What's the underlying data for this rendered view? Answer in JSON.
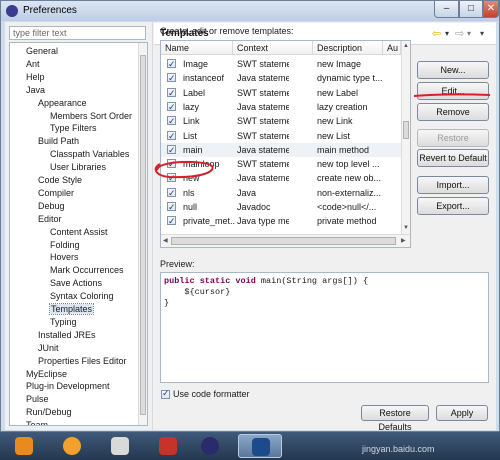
{
  "window": {
    "title": "Preferences",
    "min_label": "–",
    "max_label": "□",
    "close_label": "✕"
  },
  "filter": {
    "placeholder": "type filter text"
  },
  "tree": {
    "items": [
      {
        "label": "General",
        "level": 0
      },
      {
        "label": "Ant",
        "level": 0
      },
      {
        "label": "Help",
        "level": 0
      },
      {
        "label": "Java",
        "level": 0
      },
      {
        "label": "Appearance",
        "level": 1
      },
      {
        "label": "Members Sort Order",
        "level": 2
      },
      {
        "label": "Type Filters",
        "level": 2
      },
      {
        "label": "Build Path",
        "level": 1
      },
      {
        "label": "Classpath Variables",
        "level": 2
      },
      {
        "label": "User Libraries",
        "level": 2
      },
      {
        "label": "Code Style",
        "level": 1
      },
      {
        "label": "Compiler",
        "level": 1
      },
      {
        "label": "Debug",
        "level": 1
      },
      {
        "label": "Editor",
        "level": 1
      },
      {
        "label": "Content Assist",
        "level": 2
      },
      {
        "label": "Folding",
        "level": 2
      },
      {
        "label": "Hovers",
        "level": 2
      },
      {
        "label": "Mark Occurrences",
        "level": 2
      },
      {
        "label": "Save Actions",
        "level": 2
      },
      {
        "label": "Syntax Coloring",
        "level": 2
      },
      {
        "label": "Templates",
        "level": 2,
        "selected": true
      },
      {
        "label": "Typing",
        "level": 2
      },
      {
        "label": "Installed JREs",
        "level": 1
      },
      {
        "label": "JUnit",
        "level": 1
      },
      {
        "label": "Properties Files Editor",
        "level": 1
      },
      {
        "label": "MyEclipse",
        "level": 0
      },
      {
        "label": "Plug-in Development",
        "level": 0
      },
      {
        "label": "Pulse",
        "level": 0
      },
      {
        "label": "Run/Debug",
        "level": 0
      },
      {
        "label": "Team",
        "level": 0
      }
    ]
  },
  "page": {
    "title": "Templates",
    "description": "Create, edit or remove templates:",
    "nav": {
      "back": "⇦",
      "dropdown": "▾",
      "forward": "⇨",
      "menu": "▾"
    }
  },
  "table": {
    "headers": [
      "Name",
      "Context",
      "Description",
      "Au"
    ],
    "rows": [
      {
        "name": "Image",
        "context": "SWT statements",
        "description": "new Image",
        "checked": true
      },
      {
        "name": "instanceof",
        "context": "Java statements",
        "description": "dynamic type t...",
        "checked": true
      },
      {
        "name": "Label",
        "context": "SWT statements",
        "description": "new Label",
        "checked": true
      },
      {
        "name": "lazy",
        "context": "Java statements",
        "description": "lazy creation",
        "checked": true
      },
      {
        "name": "Link",
        "context": "SWT statements",
        "description": "new Link",
        "checked": true
      },
      {
        "name": "List",
        "context": "SWT statements",
        "description": "new List",
        "checked": true
      },
      {
        "name": "main",
        "context": "Java statements",
        "description": "main method",
        "checked": true,
        "highlighted": true
      },
      {
        "name": "mainloop",
        "context": "SWT statements",
        "description": "new top level ...",
        "checked": true
      },
      {
        "name": "new",
        "context": "Java statements",
        "description": "create new ob...",
        "checked": true
      },
      {
        "name": "nls",
        "context": "Java",
        "description": "non-externaliz...",
        "checked": true
      },
      {
        "name": "null",
        "context": "Javadoc",
        "description": "<code>null</...",
        "checked": true
      },
      {
        "name": "private_met...",
        "context": "Java type memb...",
        "description": "private method",
        "checked": true
      }
    ]
  },
  "buttons": {
    "new": "New...",
    "edit": "Edit...",
    "remove": "Remove",
    "restore_removed": "Restore Removed",
    "revert_to_default": "Revert to Default",
    "import": "Import...",
    "export": "Export...",
    "restore_defaults": "Restore Defaults",
    "apply": "Apply"
  },
  "preview": {
    "label": "Preview:",
    "line1_kw": "public static void",
    "line1_rest": " main(String args[]) {",
    "line2": "    ${cursor}",
    "line3": "}"
  },
  "formatter": {
    "label": "Use code formatter",
    "checked": true
  },
  "watermark": "jingyan.baidu.com",
  "annotation_color": "#d6202a"
}
